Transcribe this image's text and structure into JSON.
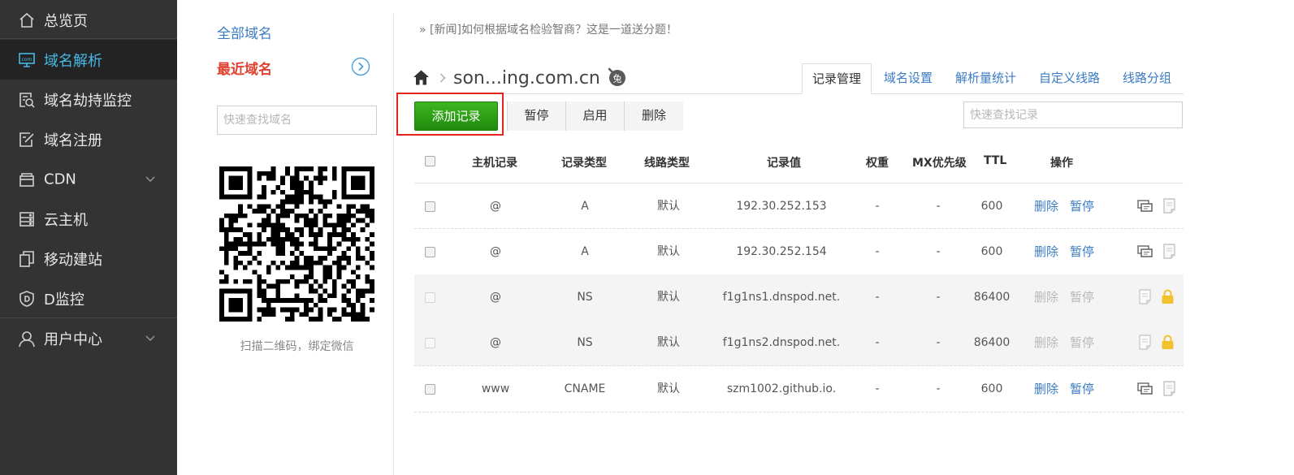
{
  "nav": {
    "items": [
      {
        "label": "总览页",
        "icon": "home-icon"
      },
      {
        "label": "域名解析",
        "icon": "dns-icon",
        "active": true
      },
      {
        "label": "域名劫持监控",
        "icon": "monitor-search-icon"
      },
      {
        "label": "域名注册",
        "icon": "register-icon"
      },
      {
        "label": "CDN",
        "icon": "cdn-icon",
        "expandable": true
      },
      {
        "label": "云主机",
        "icon": "server-icon"
      },
      {
        "label": "移动建站",
        "icon": "mobile-site-icon"
      },
      {
        "label": "D监控",
        "icon": "shield-icon"
      },
      {
        "label": "用户中心",
        "icon": "user-icon",
        "expandable": true
      }
    ]
  },
  "domain_panel": {
    "all_domains": "全部域名",
    "recent_domains": "最近域名",
    "search_placeholder": "快速查找域名",
    "qr_caption": "扫描二维码，绑定微信"
  },
  "news": "» [新闻]如何根据域名检验智商？这是一道送分题！",
  "breadcrumb": {
    "domain": "son...ing.com.cn"
  },
  "tabs": [
    {
      "label": "记录管理",
      "active": true
    },
    {
      "label": "域名设置"
    },
    {
      "label": "解析量统计"
    },
    {
      "label": "自定义线路"
    },
    {
      "label": "线路分组"
    }
  ],
  "toolbar": {
    "add_label": "添加记录",
    "pause_label": "暂停",
    "enable_label": "启用",
    "delete_label": "删除",
    "search_placeholder": "快速查找记录"
  },
  "table": {
    "headers": {
      "host": "主机记录",
      "type": "记录类型",
      "line": "线路类型",
      "value": "记录值",
      "weight": "权重",
      "mx": "MX优先级",
      "ttl": "TTL",
      "ops": "操作"
    },
    "action_delete": "删除",
    "action_pause": "暂停",
    "rows": [
      {
        "host": "@",
        "type": "A",
        "line": "默认",
        "value": "192.30.252.153",
        "weight": "-",
        "mx": "-",
        "ttl": "600",
        "locked": false
      },
      {
        "host": "@",
        "type": "A",
        "line": "默认",
        "value": "192.30.252.154",
        "weight": "-",
        "mx": "-",
        "ttl": "600",
        "locked": false
      },
      {
        "host": "@",
        "type": "NS",
        "line": "默认",
        "value": "f1g1ns1.dnspod.net.",
        "weight": "-",
        "mx": "-",
        "ttl": "86400",
        "locked": true
      },
      {
        "host": "@",
        "type": "NS",
        "line": "默认",
        "value": "f1g1ns2.dnspod.net.",
        "weight": "-",
        "mx": "-",
        "ttl": "86400",
        "locked": true
      },
      {
        "host": "www",
        "type": "CNAME",
        "line": "默认",
        "value": "szm1002.github.io.",
        "weight": "-",
        "mx": "-",
        "ttl": "600",
        "locked": false
      }
    ]
  },
  "colors": {
    "nav_bg": "#333333",
    "nav_active_bg": "#232323",
    "nav_active_text": "#45b8e6",
    "link": "#3a7bc4",
    "recent": "#e0402f",
    "add_button": "#2a9d16",
    "highlight_box": "#e4251c",
    "lock": "#f2c12e"
  }
}
